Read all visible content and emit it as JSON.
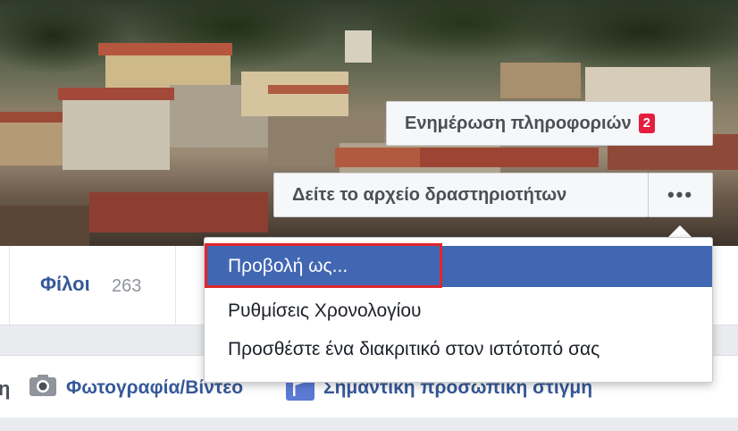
{
  "cover": {
    "update_info_label": "Ενημέρωση πληροφοριών",
    "update_info_badge": "2",
    "activity_log_label": "Δείτε το αρχείο δραστηριοτήτων",
    "more_label": "•••"
  },
  "nav": {
    "friends_label": "Φίλοι",
    "friends_count": "263"
  },
  "composer": {
    "left_fragment": "η",
    "photo_video_label": "Φωτογραφία/Βίντεο",
    "life_event_label": "Σημαντική προσωπική στιγμή"
  },
  "menu": {
    "items": [
      {
        "label": "Προβολή ως..."
      },
      {
        "label": "Ρυθμίσεις Χρονολογίου"
      },
      {
        "label": "Προσθέστε ένα διακριτικό στον ιστότοπό σας"
      }
    ]
  },
  "colors": {
    "accent": "#4267b2",
    "link": "#365899",
    "badge": "#e41e3f",
    "highlight": "#e0262b"
  },
  "icons": [
    "camera-icon",
    "flag-icon"
  ]
}
